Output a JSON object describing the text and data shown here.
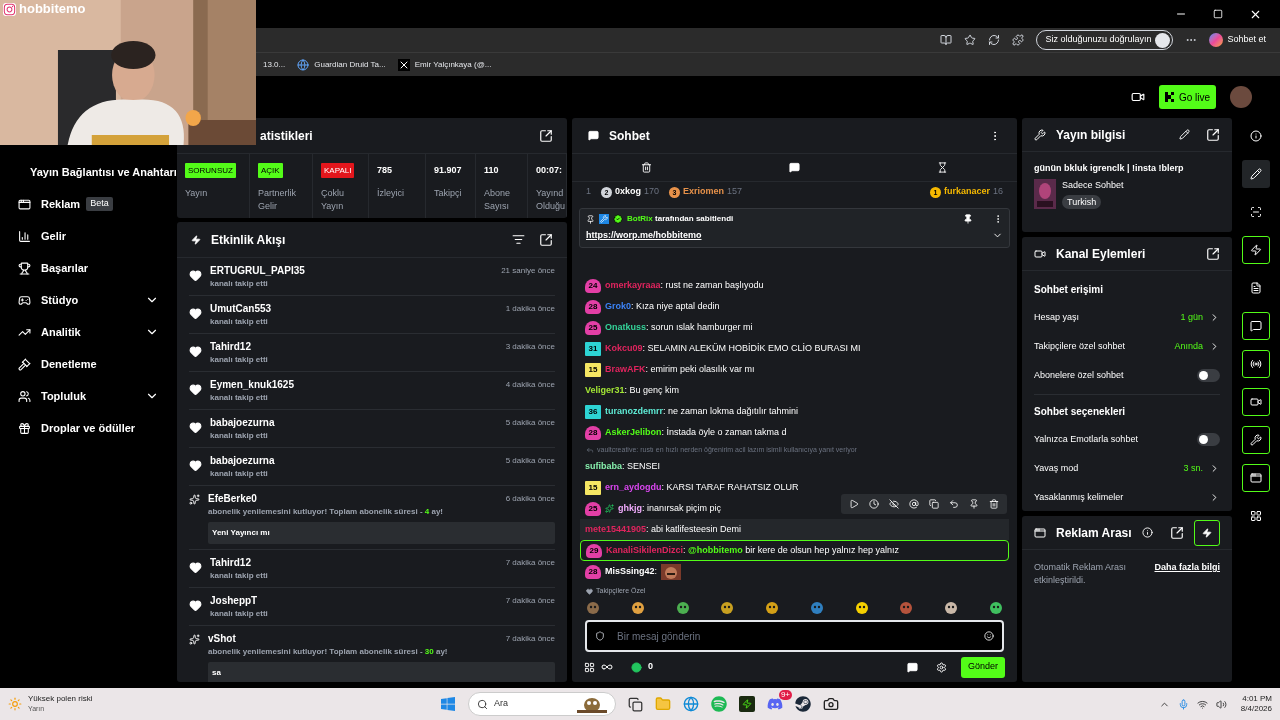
{
  "overlay": {
    "handle": "hobbitemo"
  },
  "browser": {
    "bookmarks": [
      "13.0...",
      "Guardian Druid Ta...",
      "Emir Yalçınkaya (@..."
    ],
    "verify_button": "Siz olduğunuzu doğrulayın",
    "copilot_button": "Sohbet et"
  },
  "header": {
    "go_live": "Go live"
  },
  "sidebar": {
    "items": [
      {
        "label": "Yayın Bağlantısı ve Anahtarı",
        "expandable": false
      },
      {
        "label": "Reklam",
        "badge": "Beta",
        "expandable": false
      },
      {
        "label": "Gelir",
        "expandable": false
      },
      {
        "label": "Başarılar",
        "expandable": false
      },
      {
        "label": "Stüdyo",
        "expandable": true
      },
      {
        "label": "Analitik",
        "expandable": true
      },
      {
        "label": "Denetleme",
        "expandable": false
      },
      {
        "label": "Topluluk",
        "expandable": true
      },
      {
        "label": "Droplar ve ödüller",
        "expandable": false
      }
    ]
  },
  "stats": {
    "title": "atistikleri",
    "cells": [
      {
        "kind": "badge",
        "value": "SORUNSUZ",
        "color": "#53fc18",
        "label": "Yayın"
      },
      {
        "kind": "badge",
        "value": "AÇIK",
        "color": "#53fc18",
        "label": "Partnerlik Gelir"
      },
      {
        "kind": "badge",
        "value": "KAPALI",
        "color": "#e3161c",
        "label": "Çoklu Yayın"
      },
      {
        "kind": "number",
        "value": "785",
        "label": "İzleyici"
      },
      {
        "kind": "number",
        "value": "91.907",
        "label": "Takipçi"
      },
      {
        "kind": "number",
        "value": "110",
        "label": "Abone Sayısı"
      },
      {
        "kind": "number",
        "value": "00:07:",
        "label": "Yayınd Olduğu"
      }
    ]
  },
  "activity": {
    "title": "Etkinlik Akışı",
    "events": [
      {
        "kind": "follow",
        "user": "ERTUGRUL_PAPI35",
        "action": "kanalı takip etti",
        "time": "21 saniye önce"
      },
      {
        "kind": "follow",
        "user": "UmutCan553",
        "action": "kanalı takip etti",
        "time": "1 dakika önce"
      },
      {
        "kind": "follow",
        "user": "Tahird12",
        "action": "kanalı takip etti",
        "time": "3 dakika önce"
      },
      {
        "kind": "follow",
        "user": "Eymen_knuk1625",
        "action": "kanalı takip etti",
        "time": "4 dakika önce"
      },
      {
        "kind": "follow",
        "user": "babajoezurna",
        "action": "kanalı takip etti",
        "time": "5 dakika önce"
      },
      {
        "kind": "follow",
        "user": "babajoezurna",
        "action": "kanalı takip etti",
        "time": "5 dakika önce"
      },
      {
        "kind": "sub",
        "user": "EfeBerke0",
        "action": "abonelik yenilemesini kutluyor! Toplam abonelik süresi - **4** ay!",
        "time": "6 dakika önce",
        "message": "Yeni Yayıncı mı"
      },
      {
        "kind": "follow",
        "user": "Tahird12",
        "action": "kanalı takip etti",
        "time": "7 dakika önce"
      },
      {
        "kind": "follow",
        "user": "JosheppT",
        "action": "kanalı takip etti",
        "time": "7 dakika önce"
      },
      {
        "kind": "sub",
        "user": "vShot",
        "action": "abonelik yenilemesini kutluyor! Toplam abonelik süresi - **30** ay!",
        "time": "7 dakika önce",
        "message": "sa"
      }
    ]
  },
  "chat": {
    "title": "Sohbet",
    "leaderboard": {
      "lead": "1",
      "entries": [
        {
          "rank": "2",
          "name": "0xkog",
          "points": "170",
          "color": "#d1d5db"
        },
        {
          "rank": "3",
          "name": "Exriomen",
          "points": "157",
          "color": "#e8924a"
        },
        {
          "rank": "1",
          "name": "furkanacer",
          "points": "16",
          "color": "#f5b800"
        }
      ]
    },
    "pinned": {
      "by": "BotRix",
      "note": "tarafından sabitlendi",
      "link": "https://worp.me/hobbitemo"
    },
    "messages": [
      {
        "kind": "text",
        "hovered": false,
        "mentioned": false,
        "badge": {
          "kind": "drop",
          "number": "24",
          "color": "#e33fa6"
        },
        "user": "omerkayraaa",
        "color": "#e0245e",
        "text": ": rust ne zaman başlıyodu"
      },
      {
        "kind": "text",
        "hovered": false,
        "mentioned": false,
        "badge": {
          "kind": "drop",
          "number": "28",
          "color": "#e33fa6"
        },
        "user": "Grok0",
        "color": "#3b82f6",
        "text": ": Kıza niye aptal dedin"
      },
      {
        "kind": "text",
        "hovered": false,
        "mentioned": false,
        "badge": {
          "kind": "drop",
          "number": "25",
          "color": "#e33fa6"
        },
        "user": "Onatkuss",
        "color": "#34d399",
        "text": ": sorun ıslak hamburger mi"
      },
      {
        "kind": "text",
        "hovered": false,
        "mentioned": false,
        "badge": {
          "kind": "square",
          "number": "31",
          "color": "#2dd4d4"
        },
        "user": "Kokcu09",
        "color": "#e0245e",
        "text": ": SELAMIN ALEKÜM HOBİDİK EMO CLİO BURASI MI"
      },
      {
        "kind": "text",
        "hovered": false,
        "mentioned": false,
        "badge": {
          "kind": "square",
          "number": "15",
          "color": "#f5e663"
        },
        "user": "BrawAFK",
        "color": "#e0245e",
        "text": ": emirim peki olasılık var mı"
      },
      {
        "kind": "text",
        "hovered": false,
        "mentioned": false,
        "user": "Veliger31",
        "color": "#a3e635",
        "text": ": Bu genç kim"
      },
      {
        "kind": "text",
        "hovered": false,
        "mentioned": false,
        "badge": {
          "kind": "square",
          "number": "36",
          "color": "#2dd4d4"
        },
        "user": "turanozdemrr",
        "color": "#5eead4",
        "text": ": ne zaman lokma dağıtılır tahmini"
      },
      {
        "kind": "text",
        "hovered": false,
        "mentioned": false,
        "badge": {
          "kind": "drop",
          "number": "28",
          "color": "#e33fa6"
        },
        "user": "AskerJelibon",
        "color": "#53fc18",
        "text": ": İnstada öyle o zaman takma d"
      },
      {
        "kind": "reply",
        "text": "vaultcreative: rustı en hızlı nerden öğrenirim acil lazım isimli kullanıcıya yanıt veriyor"
      },
      {
        "kind": "text",
        "hovered": false,
        "mentioned": false,
        "user": "sufibaba",
        "color": "#86efac",
        "text": ": SENSEI"
      },
      {
        "kind": "text",
        "hovered": false,
        "mentioned": false,
        "badge": {
          "kind": "square",
          "number": "15",
          "color": "#f5e663"
        },
        "user": "ern_aydogdu",
        "color": "#d946ef",
        "text": ": KARSI TARAF RAHATSIZ OLUR"
      },
      {
        "kind": "text",
        "hovered": false,
        "mentioned": false,
        "badge": {
          "kind": "drop",
          "number": "25",
          "color": "#e33fa6"
        },
        "extra_badge": true,
        "user": "ghkjg",
        "color": "#f0abfc",
        "text": ": inanırsak piçim piç"
      },
      {
        "kind": "text",
        "hovered": true,
        "mentioned": false,
        "user": "mete15441905",
        "color": "#e0245e",
        "text": ": abi katlifesteesin Demi"
      },
      {
        "kind": "text",
        "hovered": false,
        "mentioned": true,
        "badge": {
          "kind": "drop",
          "number": "29",
          "color": "#e33fa6"
        },
        "user": "KanaliSikilenDizci",
        "color": "#e0245e",
        "text": ": **@hobbitemo** bir kere de olsun hep yalnız hep yalnız"
      },
      {
        "kind": "emote",
        "hovered": false,
        "mentioned": false,
        "badge": {
          "kind": "drop",
          "number": "28",
          "color": "#e33fa6"
        },
        "user": "MisSsing42",
        "color": "#ffffff",
        "text": ":"
      }
    ],
    "emote_set": "Takipçilere Özel",
    "input": {
      "placeholder": "Bir mesaj gönderin"
    },
    "points": "0",
    "send": "Gönder"
  },
  "stream_info": {
    "title": "Yayın bilgisi",
    "stream_title": "günün bkluk igrenclk | !insta !blerp",
    "category": "Sadece Sohbet",
    "tag": "Turkish"
  },
  "channel_actions": {
    "title": "Kanal Eylemleri",
    "sections": [
      {
        "heading": "Sohbet erişimi",
        "rows": [
          {
            "kind": "value",
            "label": "Hesap yaşı",
            "value": "1 gün"
          },
          {
            "kind": "value",
            "label": "Takipçilere özel sohbet",
            "value": "Anında"
          },
          {
            "kind": "toggle",
            "label": "Abonelere özel sohbet",
            "on": false
          }
        ]
      },
      {
        "heading": "Sohbet seçenekleri",
        "rows": [
          {
            "kind": "toggle",
            "label": "Yalnızca Emotlarla sohbet",
            "on": false
          },
          {
            "kind": "value",
            "label": "Yavaş mod",
            "value": "3 sn."
          },
          {
            "kind": "link",
            "label": "Yasaklanmış kelimeler"
          }
        ]
      }
    ]
  },
  "ad_break": {
    "title": "Reklam Arası",
    "text": "Otomatik Reklam Arası etkinleştirildi.",
    "link": "Daha fazla bilgi"
  },
  "tools": [
    {
      "selected": false
    },
    {
      "selected": false
    },
    {
      "selected": false
    },
    {
      "selected": true
    },
    {
      "selected": false
    },
    {
      "selected": true
    },
    {
      "selected": true
    },
    {
      "selected": true
    },
    {
      "selected": true
    },
    {
      "selected": true
    },
    {
      "selected": false
    }
  ],
  "taskbar": {
    "weather_title": "Yüksek polen riski",
    "weather_sub": "Yarın",
    "search": "Ara",
    "discord_badge": "9+",
    "time": "4:01 PM",
    "date": "8/4/2026"
  }
}
